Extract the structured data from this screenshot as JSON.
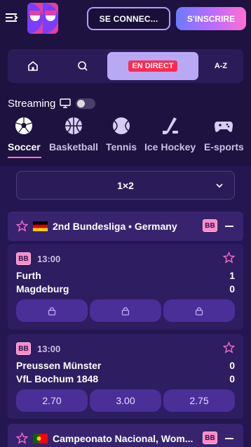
{
  "header": {
    "login_label": "SE CONNEC...",
    "signup_label": "S'INSCRIRE"
  },
  "nav": {
    "live_label": "EN DIRECT",
    "az_label": "A-Z"
  },
  "streaming": {
    "label": "Streaming",
    "enabled": false
  },
  "sports": [
    {
      "label": "Soccer",
      "icon": "soccer-ball-icon",
      "active": true
    },
    {
      "label": "Basketball",
      "icon": "basketball-icon",
      "active": false
    },
    {
      "label": "Tennis",
      "icon": "tennis-ball-icon",
      "active": false
    },
    {
      "label": "Ice Hockey",
      "icon": "hockey-stick-icon",
      "active": false
    },
    {
      "label": "E-sports",
      "icon": "gamepad-icon",
      "active": false
    }
  ],
  "market_selector": {
    "value": "1×2"
  },
  "leagues": [
    {
      "name": "2nd Bundesliga • Germany",
      "badge": "BB",
      "flag": "germany-flag-icon",
      "matches": [
        {
          "badge": "BB",
          "time": "13:00",
          "home": "Furth",
          "away": "Magdeburg",
          "home_score": "1",
          "away_score": "0",
          "locked": true,
          "odds": []
        },
        {
          "badge": "BB",
          "time": "13:00",
          "home": "Preussen Münster",
          "away": "VfL Bochum 1848",
          "home_score": "0",
          "away_score": "0",
          "locked": false,
          "odds": [
            "2.70",
            "3.00",
            "2.75"
          ]
        }
      ]
    },
    {
      "name": "Campeonato Nacional, Wom...",
      "badge": "BB",
      "flag": "portugal-flag-icon",
      "matches": []
    }
  ],
  "colors": {
    "background": "#1e1240",
    "accent_pink": "#ff6fd0",
    "live_red": "#ff2a4f",
    "odds_button": "#4a2f99"
  }
}
